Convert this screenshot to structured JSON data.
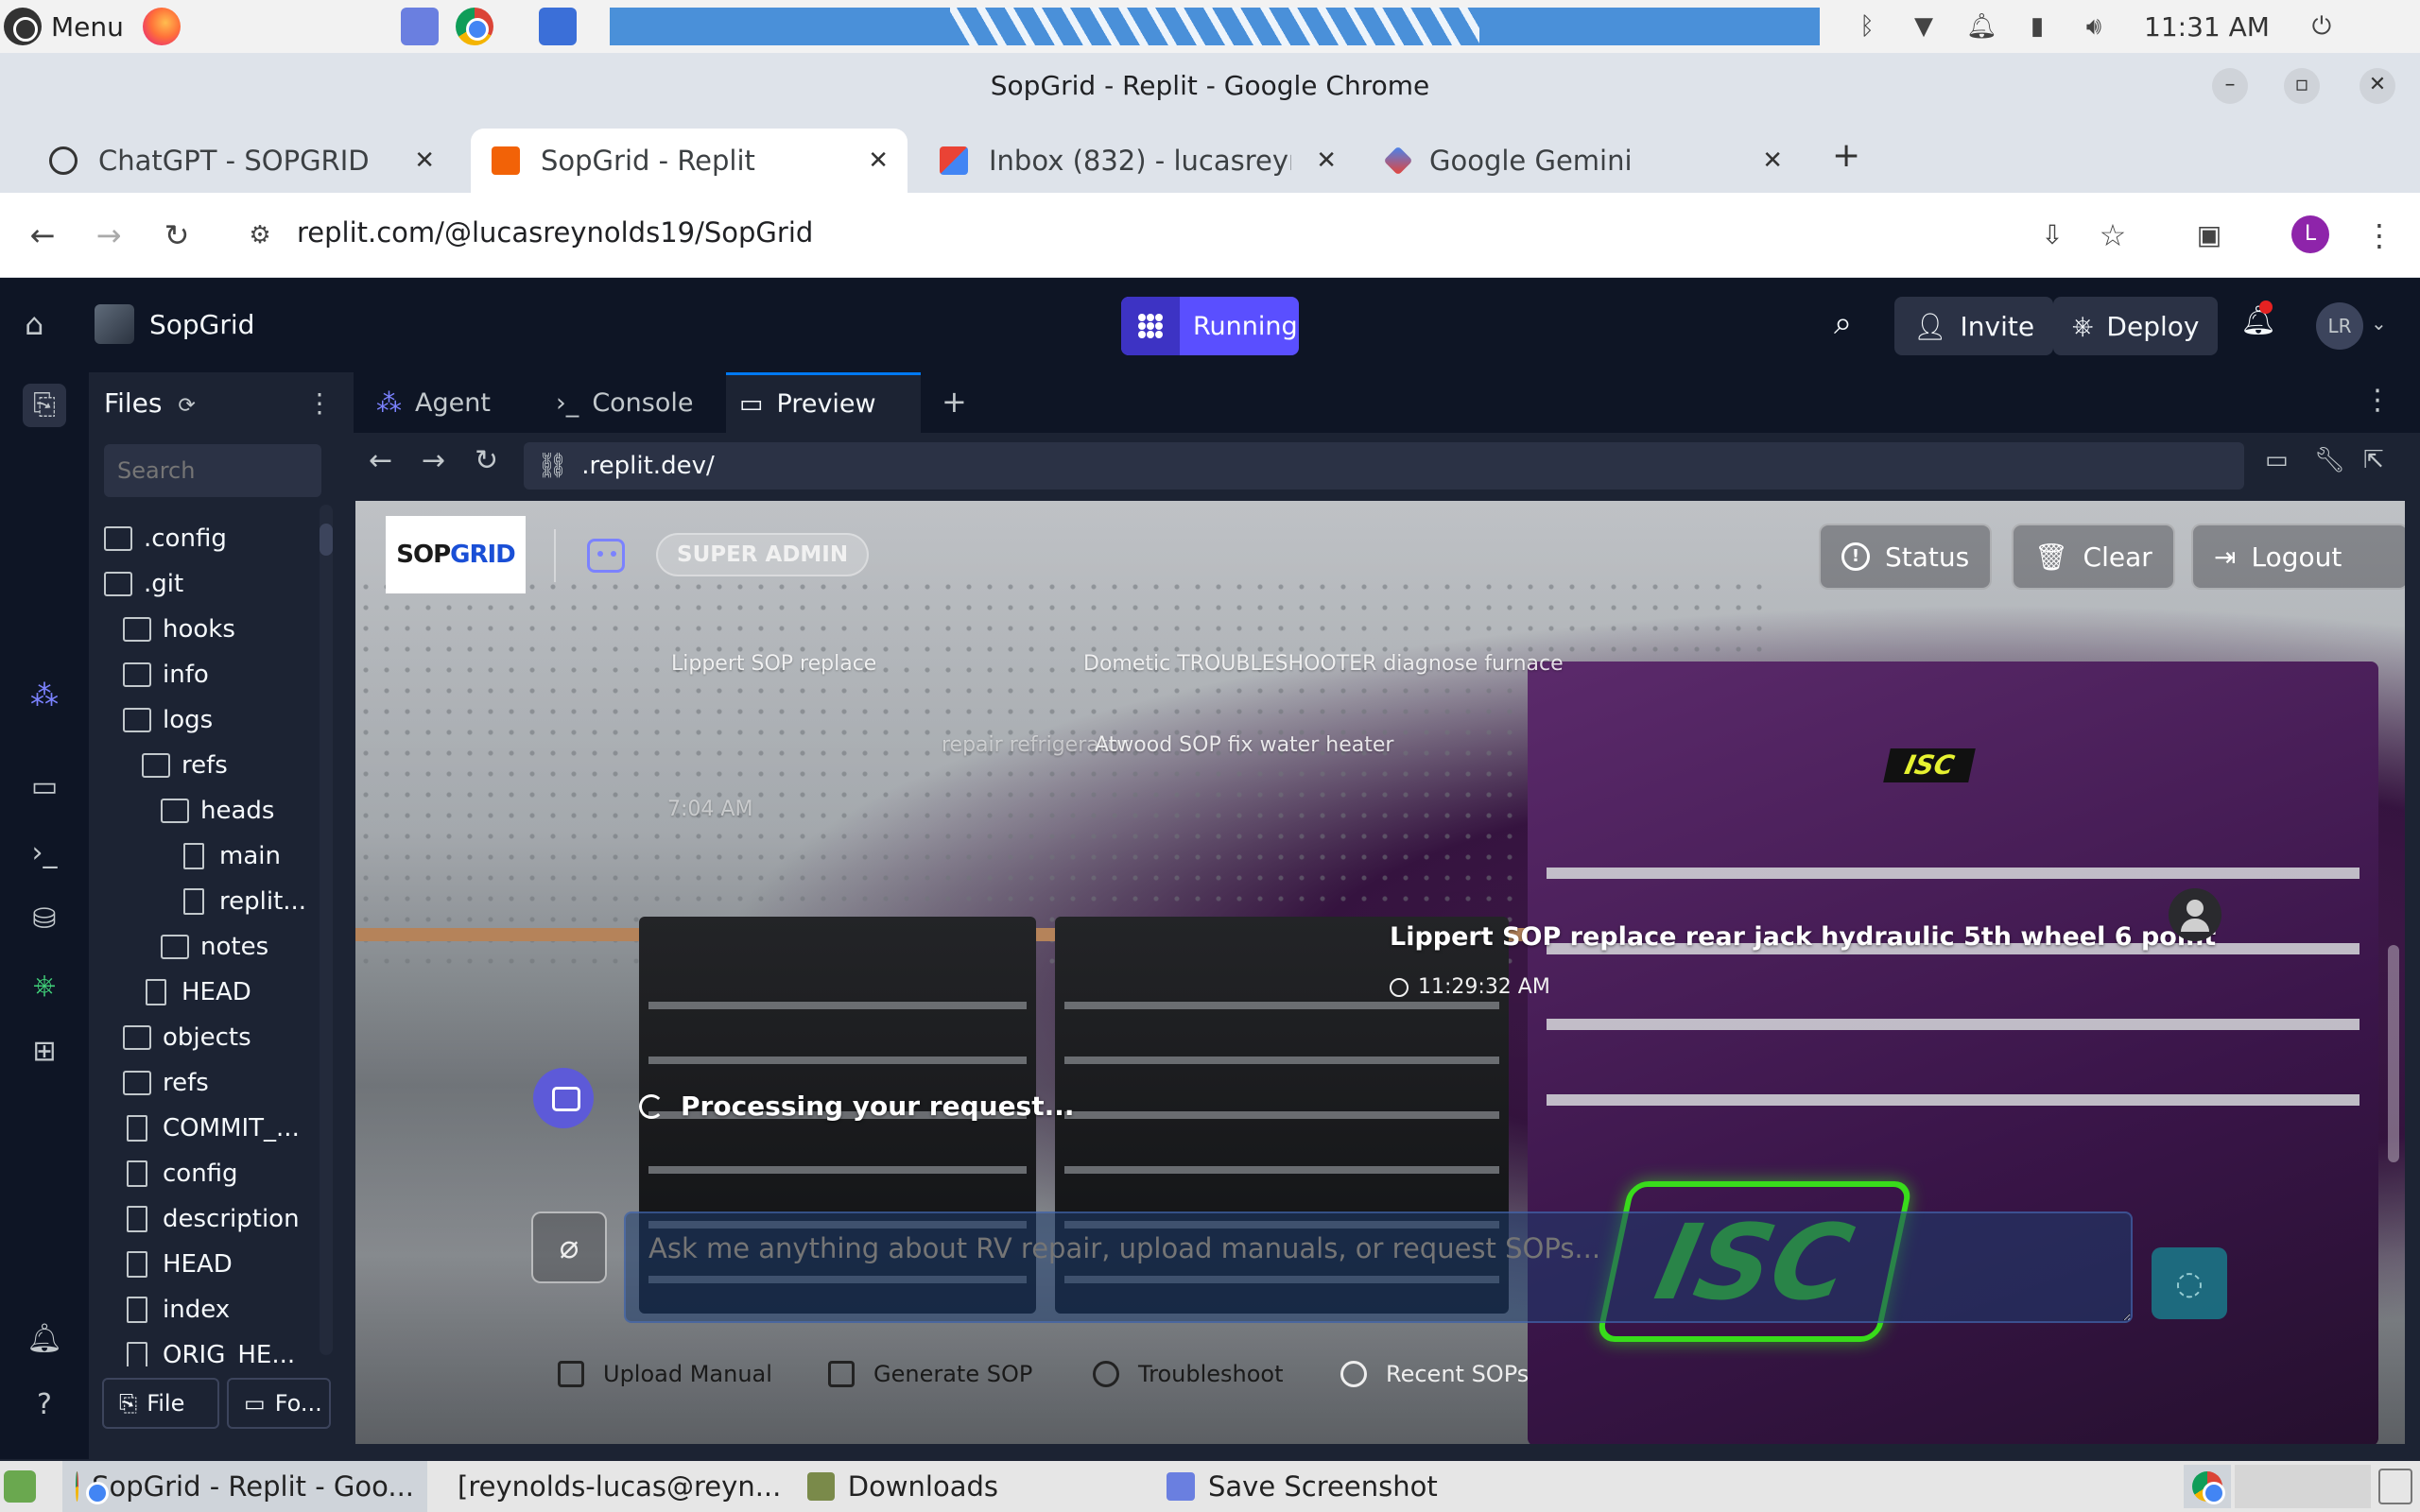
{
  "os": {
    "menu_label": "Menu",
    "clock": "11:31 AM"
  },
  "browser": {
    "window_title": "SopGrid - Replit - Google Chrome",
    "tabs": [
      {
        "label": "ChatGPT - SOPGRID",
        "icon": "chatgpt-icon"
      },
      {
        "label": "SopGrid - Replit",
        "icon": "replit-icon"
      },
      {
        "label": "Inbox (832) - lucasreynolds",
        "icon": "gmail-icon"
      },
      {
        "label": "Google Gemini",
        "icon": "gemini-icon"
      }
    ],
    "url": "replit.com/@lucasreynolds19/SopGrid",
    "profile_initial": "L"
  },
  "replit": {
    "project_name": "SopGrid",
    "run_status": "Running",
    "invite_label": "Invite",
    "deploy_label": "Deploy",
    "user_initials": "LR",
    "files": {
      "header": "Files",
      "search_placeholder": "Search",
      "tree": [
        {
          "name": ".config",
          "type": "folder",
          "depth": 0
        },
        {
          "name": ".git",
          "type": "folder",
          "depth": 0
        },
        {
          "name": "hooks",
          "type": "folder",
          "depth": 1
        },
        {
          "name": "info",
          "type": "folder",
          "depth": 1
        },
        {
          "name": "logs",
          "type": "folder",
          "depth": 1
        },
        {
          "name": "refs",
          "type": "folder",
          "depth": 2
        },
        {
          "name": "heads",
          "type": "folder",
          "depth": 3
        },
        {
          "name": "main",
          "type": "file",
          "depth": 4
        },
        {
          "name": "replit...",
          "type": "file",
          "depth": 4
        },
        {
          "name": "notes",
          "type": "folder",
          "depth": 3
        },
        {
          "name": "HEAD",
          "type": "file",
          "depth": 2
        },
        {
          "name": "objects",
          "type": "folder",
          "depth": 1
        },
        {
          "name": "refs",
          "type": "folder",
          "depth": 1
        },
        {
          "name": "COMMIT_...",
          "type": "file",
          "depth": 1
        },
        {
          "name": "config",
          "type": "file",
          "depth": 1
        },
        {
          "name": "description",
          "type": "file",
          "depth": 1
        },
        {
          "name": "HEAD",
          "type": "file",
          "depth": 1
        },
        {
          "name": "index",
          "type": "file",
          "depth": 1
        },
        {
          "name": "ORIG_HE...",
          "type": "file",
          "depth": 1
        }
      ],
      "new_file_label": "File",
      "new_folder_label": "Fo..."
    },
    "pane_tabs": [
      {
        "label": "Agent"
      },
      {
        "label": "Console"
      },
      {
        "label": "Preview"
      }
    ],
    "preview_url": ".replit.dev/"
  },
  "app": {
    "logo_text_a": "SOP",
    "logo_text_b": "GRID",
    "role_badge": "SUPER ADMIN",
    "status_label": "Status",
    "clear_label": "Clear",
    "logout_label": "Logout",
    "ghost_lines": [
      "Lippert SOP replace",
      "Dometic TROUBLESHOOTER diagnose furnace",
      "repair refrigerator",
      "Atwood SOP fix water heater",
      "7:04 AM"
    ],
    "message_title": "Lippert SOP replace rear jack hydraulic 5th wheel 6 point",
    "message_time": "11:29:32 AM",
    "processing_text": "Processing your request...",
    "input_placeholder": "Ask me anything about RV repair, upload manuals, or request SOPs...",
    "quick_actions": [
      {
        "label": "Upload Manual",
        "icon": "document-icon"
      },
      {
        "label": "Generate SOP",
        "icon": "wrench-icon"
      },
      {
        "label": "Troubleshoot",
        "icon": "alert-circle-icon"
      },
      {
        "label": "Recent SOPs",
        "icon": "check-circle-icon"
      }
    ]
  },
  "taskbar": {
    "items": [
      {
        "label": "SopGrid - Replit - Goo..."
      },
      {
        "label": "[reynolds-lucas@reyn..."
      },
      {
        "label": "Downloads"
      },
      {
        "label": "Save Screenshot"
      }
    ]
  },
  "colors": {
    "replit_accent": "#5a4fff",
    "replit_bg": "#0e1525",
    "chest_purple": "#4a1f55",
    "isc_green": "#39ff14"
  }
}
